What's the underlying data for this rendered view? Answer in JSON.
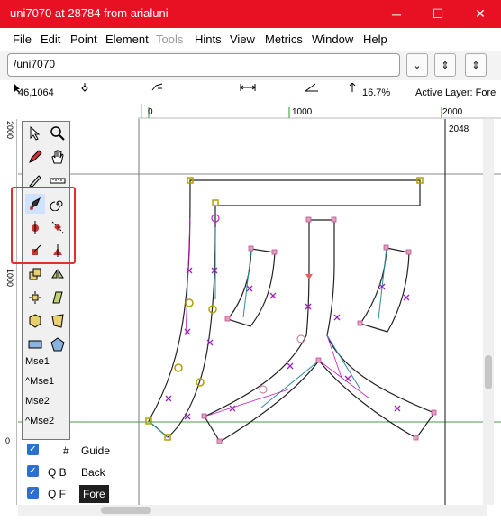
{
  "window": {
    "title": "uni7070 at 28784 from arialuni",
    "minimize": "─",
    "maximize": "☐",
    "close": "✕"
  },
  "menu": [
    "File",
    "Edit",
    "Point",
    "Element",
    "Tools",
    "Hints",
    "View",
    "Metrics",
    "Window",
    "Help"
  ],
  "menu_disabled": "Tools",
  "address": {
    "value": "/uni7070",
    "dropdown": "⌄",
    "btn1": "⇕",
    "btn2": "⇕"
  },
  "status": {
    "coords": "46,1064",
    "zoom": "16.7%",
    "active_layer": "Active Layer: Fore"
  },
  "ruler": {
    "h": [
      "0",
      "1000",
      "2000"
    ],
    "v": [
      "2000",
      "1000",
      "0"
    ],
    "advance_label": "2048"
  },
  "mouse": [
    "Mse1",
    "^Mse1",
    "Mse2",
    "^Mse2"
  ],
  "layers": [
    {
      "check": "✓",
      "letters": "#",
      "name": "Guide"
    },
    {
      "check": "✓",
      "letters": "Q  B",
      "name": "Back"
    },
    {
      "check": "✓",
      "letters": "Q  F",
      "name": "Fore"
    }
  ],
  "colors": {
    "titlebar": "#e81123",
    "highlight": "#e03030",
    "fore_layer_bg": "#1f1f1f"
  }
}
